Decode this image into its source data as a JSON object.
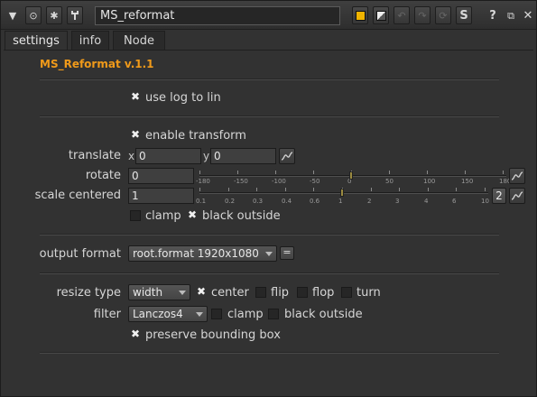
{
  "window": {
    "node_name": "MS_reformat",
    "help_label": "?",
    "s_label": "S"
  },
  "tabs": [
    {
      "label": "settings",
      "active": true
    },
    {
      "label": "info",
      "active": false
    },
    {
      "label": "Node",
      "active": false
    }
  ],
  "panel": {
    "title": "MS_Reformat v.1.1",
    "use_log_to_lin": {
      "label": "use log to lin",
      "checked": true
    },
    "enable_transform": {
      "label": "enable transform",
      "checked": true
    },
    "translate": {
      "label": "translate",
      "x_label": "x",
      "x_value": "0",
      "y_label": "y",
      "y_value": "0"
    },
    "rotate": {
      "label": "rotate",
      "value": "0",
      "ticks": [
        "-180",
        "-150",
        "-100",
        "-50",
        "0",
        "50",
        "100",
        "150",
        "180"
      ]
    },
    "scale": {
      "label": "scale centered",
      "value": "1",
      "channels_button": "2",
      "ticks": [
        "0.1",
        "0.2",
        "0.3",
        "0.4",
        "0.6",
        "1",
        "2",
        "3",
        "4",
        "6",
        "10"
      ]
    },
    "clamp": {
      "label": "clamp",
      "checked": false
    },
    "black_outside_top": {
      "label": "black outside",
      "checked": true
    },
    "output_format": {
      "label": "output format",
      "value": "root.format 1920x1080",
      "eq_button": "="
    },
    "resize_type": {
      "label": "resize type",
      "value": "width"
    },
    "center": {
      "label": "center",
      "checked": true
    },
    "flip": {
      "label": "flip",
      "checked": false
    },
    "flop": {
      "label": "flop",
      "checked": false
    },
    "turn": {
      "label": "turn",
      "checked": false
    },
    "filter": {
      "label": "filter",
      "value": "Lanczos4"
    },
    "clamp2": {
      "label": "clamp",
      "checked": false
    },
    "black_outside2": {
      "label": "black outside",
      "checked": false
    },
    "preserve_bbox": {
      "label": "preserve bounding box",
      "checked": true
    }
  },
  "colors": {
    "accent": "#f09a1a",
    "node_color": "#f0b400"
  }
}
